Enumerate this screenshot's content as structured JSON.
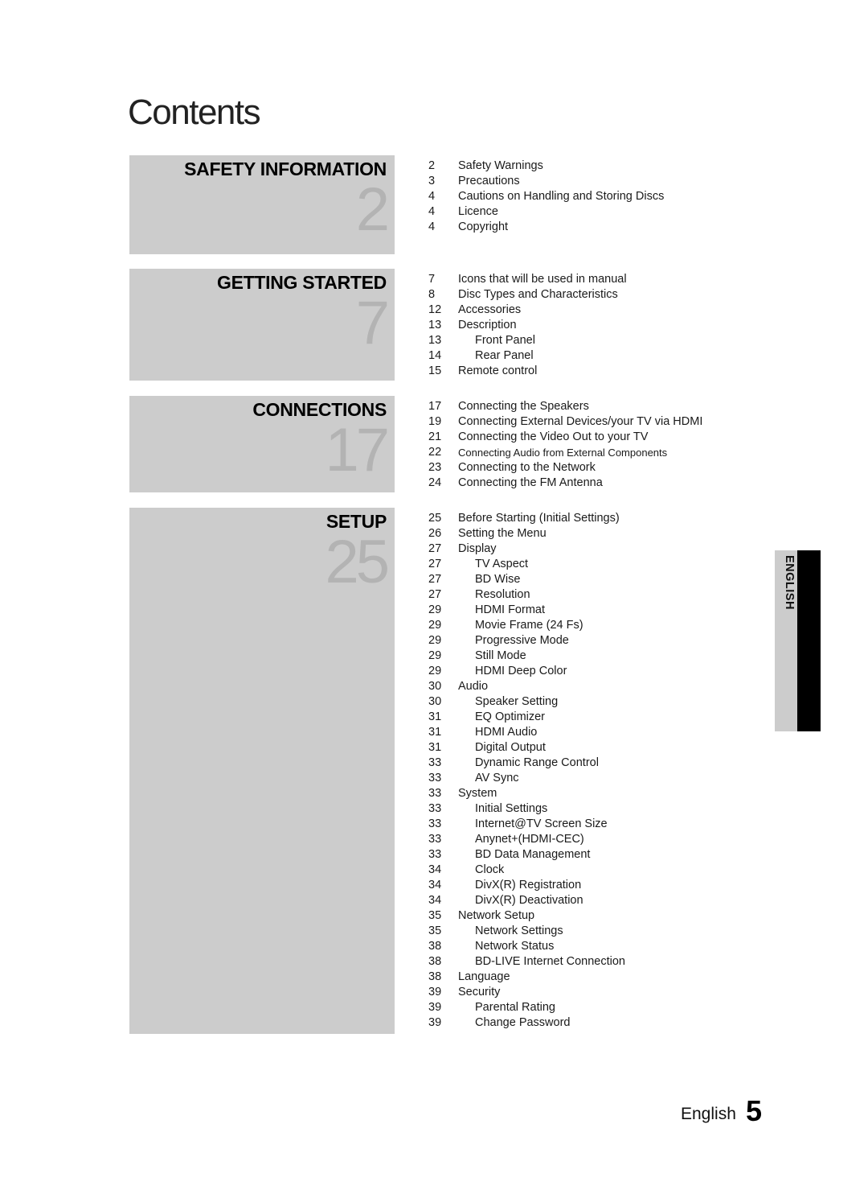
{
  "page": {
    "title": "Contents",
    "footer_language": "English",
    "page_number": "5",
    "language_tab": "ENGLISH"
  },
  "chapters": [
    {
      "title": "SAFETY INFORMATION",
      "start_page": "2"
    },
    {
      "title": "GETTING STARTED",
      "start_page": "7"
    },
    {
      "title": "CONNECTIONS",
      "start_page": "17"
    },
    {
      "title": "SETUP",
      "start_page": "25"
    }
  ],
  "toc": [
    {
      "entries": [
        {
          "page": "2",
          "label": "Safety Warnings",
          "level": 1
        },
        {
          "page": "3",
          "label": "Precautions",
          "level": 1
        },
        {
          "page": "4",
          "label": "Cautions on Handling and Storing Discs",
          "level": 1
        },
        {
          "page": "4",
          "label": "Licence",
          "level": 1
        },
        {
          "page": "4",
          "label": "Copyright",
          "level": 1
        }
      ]
    },
    {
      "entries": [
        {
          "page": "7",
          "label": "Icons that will be used in manual",
          "level": 1
        },
        {
          "page": "8",
          "label": "Disc Types and Characteristics",
          "level": 1
        },
        {
          "page": "12",
          "label": "Accessories",
          "level": 1
        },
        {
          "page": "13",
          "label": "Description",
          "level": 1
        },
        {
          "page": "13",
          "label": "Front Panel",
          "level": 2
        },
        {
          "page": "14",
          "label": "Rear Panel",
          "level": 2
        },
        {
          "page": "15",
          "label": "Remote control",
          "level": 1
        }
      ]
    },
    {
      "entries": [
        {
          "page": "17",
          "label": "Connecting the Speakers",
          "level": 1
        },
        {
          "page": "19",
          "label": "Connecting External Devices/your TV via HDMI",
          "level": 1
        },
        {
          "page": "21",
          "label": "Connecting the Video Out to your TV",
          "level": 1
        },
        {
          "page": "22",
          "label": "Connecting Audio from External Components",
          "level": 1,
          "small": true
        },
        {
          "page": "23",
          "label": "Connecting to the Network",
          "level": 1
        },
        {
          "page": "24",
          "label": "Connecting the FM Antenna",
          "level": 1
        }
      ]
    },
    {
      "entries": [
        {
          "page": "25",
          "label": "Before Starting (Initial Settings)",
          "level": 1
        },
        {
          "page": "26",
          "label": "Setting the Menu",
          "level": 1
        },
        {
          "page": "27",
          "label": "Display",
          "level": 1
        },
        {
          "page": "27",
          "label": "TV Aspect",
          "level": 2
        },
        {
          "page": "27",
          "label": "BD Wise",
          "level": 2
        },
        {
          "page": "27",
          "label": "Resolution",
          "level": 2
        },
        {
          "page": "29",
          "label": "HDMI Format",
          "level": 2
        },
        {
          "page": "29",
          "label": "Movie Frame (24 Fs)",
          "level": 2
        },
        {
          "page": "29",
          "label": "Progressive Mode",
          "level": 2
        },
        {
          "page": "29",
          "label": "Still Mode",
          "level": 2
        },
        {
          "page": "29",
          "label": "HDMI Deep Color",
          "level": 2
        },
        {
          "page": "30",
          "label": "Audio",
          "level": 1
        },
        {
          "page": "30",
          "label": "Speaker Setting",
          "level": 2
        },
        {
          "page": "31",
          "label": "EQ Optimizer",
          "level": 2
        },
        {
          "page": "31",
          "label": "HDMI Audio",
          "level": 2
        },
        {
          "page": "31",
          "label": "Digital Output",
          "level": 2
        },
        {
          "page": "33",
          "label": "Dynamic Range Control",
          "level": 2
        },
        {
          "page": "33",
          "label": "AV Sync",
          "level": 2
        },
        {
          "page": "33",
          "label": "System",
          "level": 1
        },
        {
          "page": "33",
          "label": "Initial Settings",
          "level": 2
        },
        {
          "page": "33",
          "label": "Internet@TV Screen Size",
          "level": 2
        },
        {
          "page": "33",
          "label": "Anynet+(HDMI-CEC)",
          "level": 2
        },
        {
          "page": "33",
          "label": "BD Data Management",
          "level": 2
        },
        {
          "page": "34",
          "label": "Clock",
          "level": 2
        },
        {
          "page": "34",
          "label": "DivX(R) Registration",
          "level": 2
        },
        {
          "page": "34",
          "label": "DivX(R) Deactivation",
          "level": 2
        },
        {
          "page": "35",
          "label": "Network Setup",
          "level": 1
        },
        {
          "page": "35",
          "label": "Network Settings",
          "level": 2
        },
        {
          "page": "38",
          "label": "Network Status",
          "level": 2
        },
        {
          "page": "38",
          "label": "BD-LIVE Internet Connection",
          "level": 2
        },
        {
          "page": "38",
          "label": "Language",
          "level": 1
        },
        {
          "page": "39",
          "label": "Security",
          "level": 1
        },
        {
          "page": "39",
          "label": "Parental Rating",
          "level": 2
        },
        {
          "page": "39",
          "label": "Change Password",
          "level": 2
        }
      ]
    }
  ]
}
